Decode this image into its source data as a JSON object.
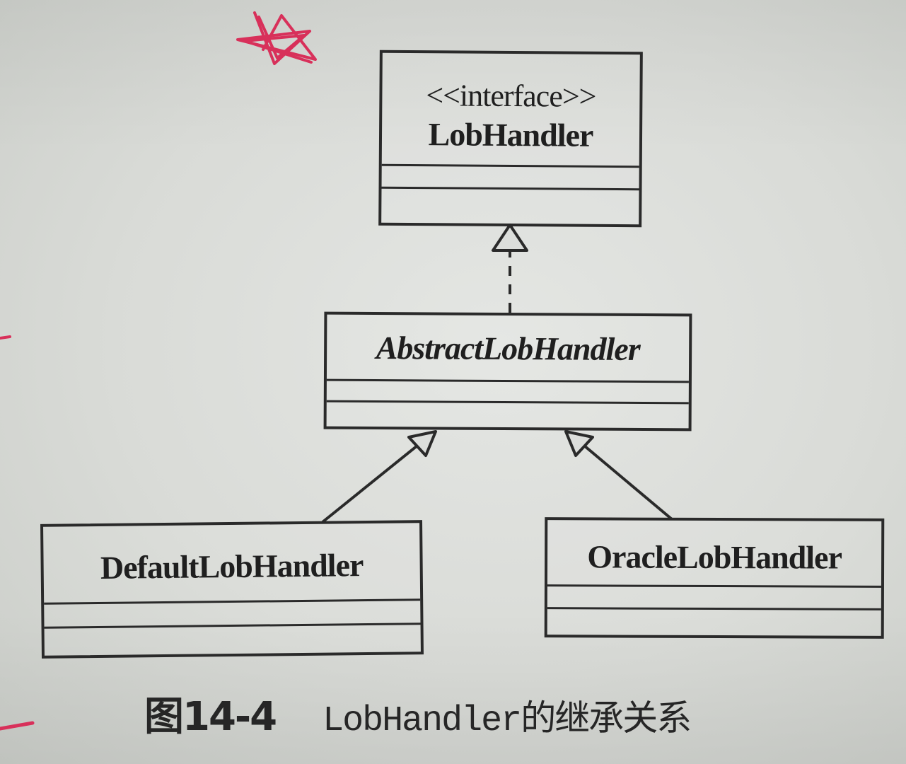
{
  "diagram": {
    "classes": {
      "lob_handler": {
        "stereotype": "<<interface>>",
        "name": "LobHandler"
      },
      "abstract_lob_handler": {
        "name": "AbstractLobHandler",
        "abstract": true
      },
      "default_lob_handler": {
        "name": "DefaultLobHandler"
      },
      "oracle_lob_handler": {
        "name": "OracleLobHandler"
      }
    },
    "relations": [
      {
        "from": "AbstractLobHandler",
        "to": "LobHandler",
        "type": "realization"
      },
      {
        "from": "DefaultLobHandler",
        "to": "AbstractLobHandler",
        "type": "generalization"
      },
      {
        "from": "OracleLobHandler",
        "to": "AbstractLobHandler",
        "type": "generalization"
      }
    ]
  },
  "caption": {
    "figure_number": "图14-4",
    "text": "LobHandler的继承关系"
  },
  "colors": {
    "ink": "#2a2a2a",
    "pen_mark": "#d8305a",
    "paper": "#dcdedb"
  }
}
